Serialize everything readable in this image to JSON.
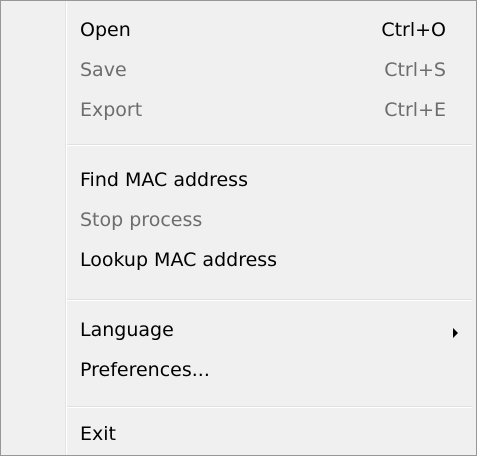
{
  "menu": {
    "items": [
      {
        "label": "Open",
        "shortcut": "Ctrl+O",
        "enabled": true
      },
      {
        "label": "Save",
        "shortcut": "Ctrl+S",
        "enabled": false
      },
      {
        "label": "Export",
        "shortcut": "Ctrl+E",
        "enabled": false
      },
      {
        "label": "Find MAC address",
        "shortcut": "",
        "enabled": true
      },
      {
        "label": "Stop process",
        "shortcut": "",
        "enabled": false
      },
      {
        "label": "Lookup MAC address",
        "shortcut": "",
        "enabled": true
      },
      {
        "label": "Language",
        "shortcut": "",
        "enabled": true,
        "submenu_icon": "submenu-arrow-right-icon"
      },
      {
        "label": "Preferences...",
        "shortcut": "",
        "enabled": true
      },
      {
        "label": "Exit",
        "shortcut": "",
        "enabled": true
      }
    ]
  },
  "colors": {
    "background": "#f0f0f0",
    "enabled_text": "#000000",
    "disabled_text": "#6d6d6d",
    "border": "#979797"
  }
}
